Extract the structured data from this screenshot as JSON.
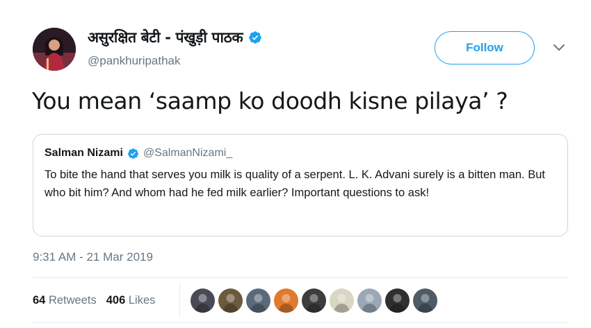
{
  "author": {
    "display_name": "असुरक्षित बेटी - पंखुड़ी पाठक",
    "handle": "@pankhuripathak",
    "verified": true
  },
  "actions": {
    "follow_label": "Follow"
  },
  "tweet": {
    "text": "You mean ‘saamp ko doodh kisne pilaya’ ?"
  },
  "quoted_tweet": {
    "name": "Salman Nizami",
    "handle": "@SalmanNizami_",
    "verified": true,
    "text": "To bite the hand that serves you milk is quality of a serpent. L. K. Advani surely is a bitten man. But who bit him? And whom had he fed milk earlier? Important questions to ask!"
  },
  "timestamp": "9:31 AM - 21 Mar 2019",
  "stats": {
    "retweets_count": "64",
    "retweets_label": "Retweets",
    "likes_count": "406",
    "likes_label": "Likes"
  },
  "likers": [
    {
      "icon": "user-avatar",
      "color": "#4a4a55"
    },
    {
      "icon": "user-avatar",
      "color": "#6b5a3e"
    },
    {
      "icon": "user-avatar",
      "color": "#5a6a7a"
    },
    {
      "icon": "user-avatar",
      "color": "#e07a2e"
    },
    {
      "icon": "user-avatar",
      "color": "#3d3d3d"
    },
    {
      "icon": "user-avatar",
      "color": "#d9d6c4"
    },
    {
      "icon": "user-avatar",
      "color": "#9aa7b5"
    },
    {
      "icon": "user-avatar",
      "color": "#2f2f2f"
    },
    {
      "icon": "user-avatar",
      "color": "#4f5b66"
    }
  ],
  "colors": {
    "accent": "#1da1f2",
    "text": "#14171a",
    "secondary": "#657786",
    "border": "#ccd6dd"
  }
}
